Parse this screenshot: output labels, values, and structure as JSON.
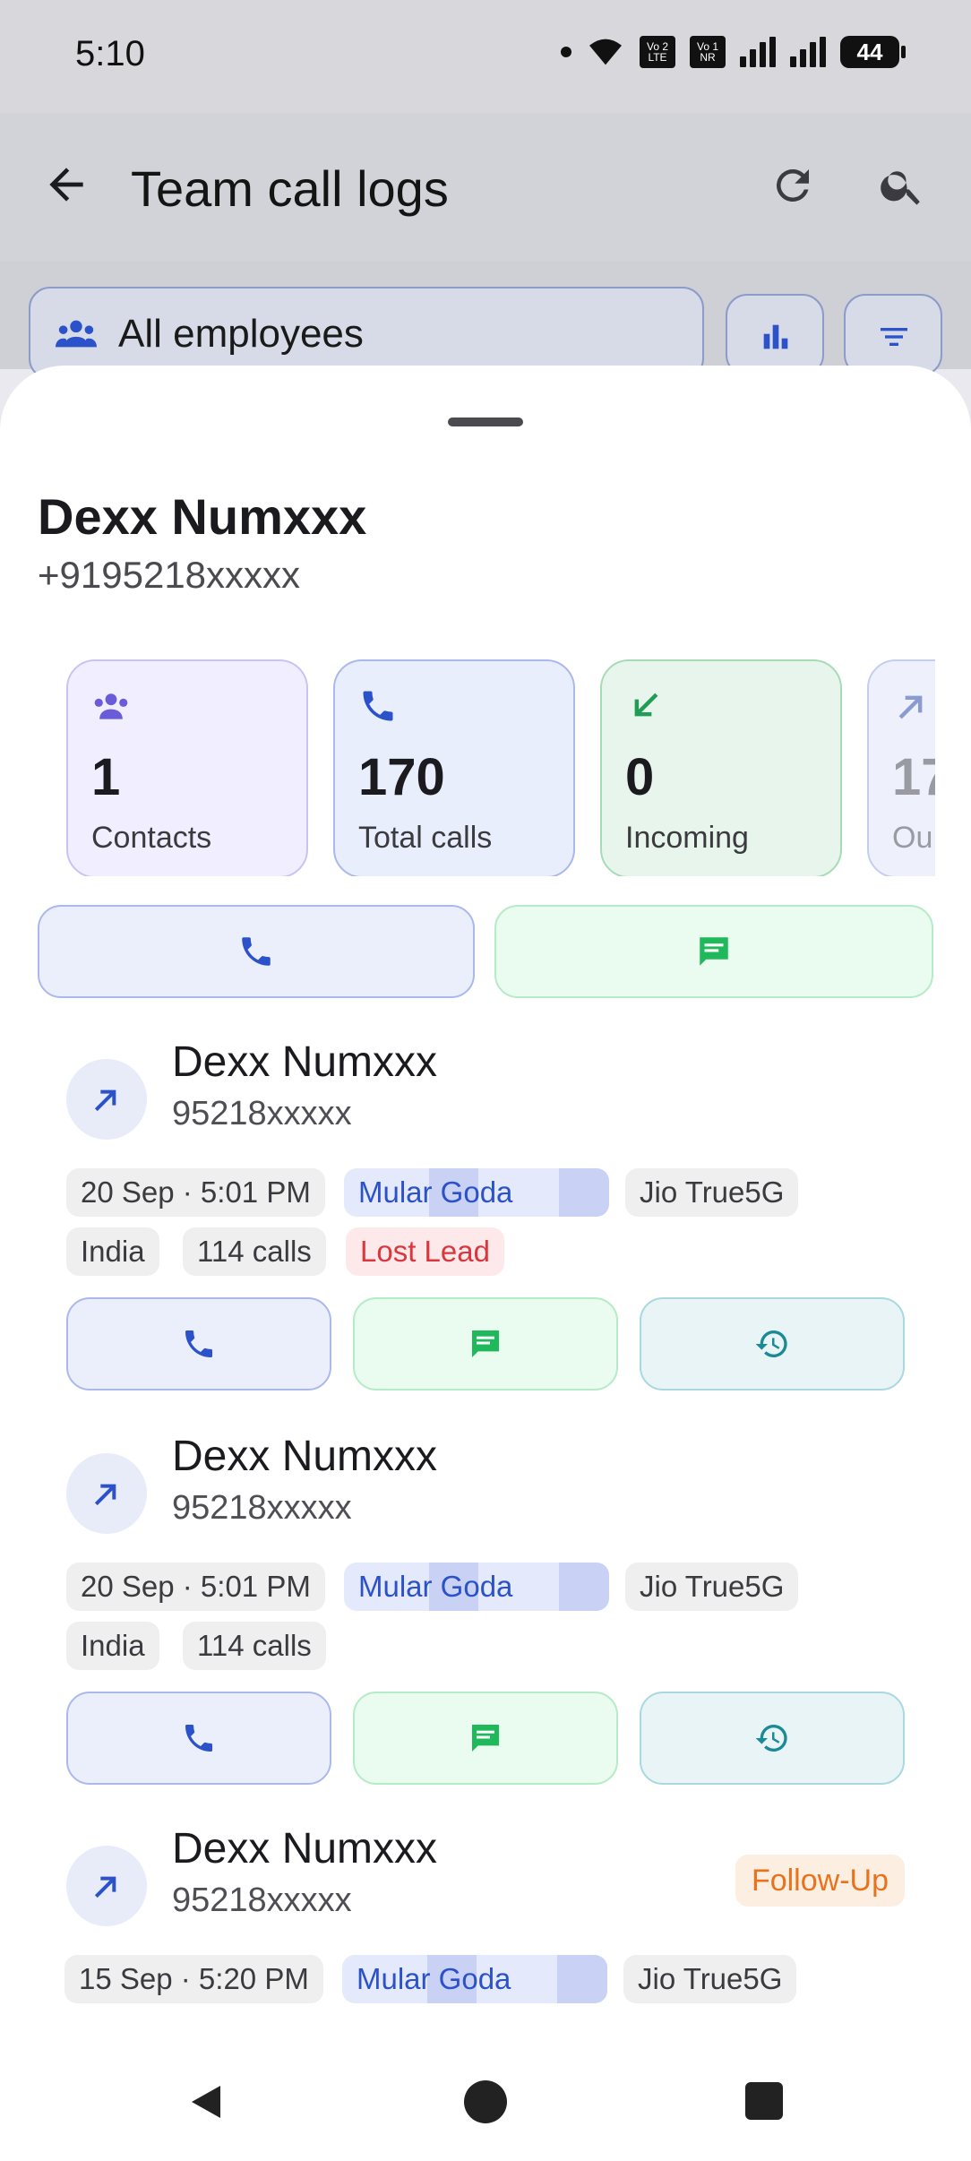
{
  "status_bar": {
    "time": "5:10",
    "sim1_label": "Vo 2 LTE",
    "sim2_label": "Vo 1 NR",
    "battery": "44"
  },
  "app_bar": {
    "title": "Team call logs"
  },
  "filter": {
    "employees_label": "All employees"
  },
  "sheet": {
    "name": "Dexx Numxxx",
    "phone": "+9195218xxxxx",
    "stats": [
      {
        "value": "1",
        "label": "Contacts",
        "icon": "group-icon",
        "color": "#6a5bd8"
      },
      {
        "value": "170",
        "label": "Total calls",
        "icon": "phone-icon",
        "color": "#2c52c9"
      },
      {
        "value": "0",
        "label": "Incoming",
        "icon": "incoming-arrow-icon",
        "color": "#1f9d55"
      },
      {
        "value": "17",
        "label": "Ou",
        "icon": "outgoing-arrow-icon",
        "color": "#8a9bd0"
      }
    ]
  },
  "logs": [
    {
      "name": "Dexx Numxxx",
      "number": "95218xxxxx",
      "datetime": "20 Sep · 5:01 PM",
      "employee": "Mular Goda",
      "network": "Jio True5G",
      "country": "India",
      "calls": "114 calls",
      "tag": "Lost Lead"
    },
    {
      "name": "Dexx Numxxx",
      "number": "95218xxxxx",
      "datetime": "20 Sep · 5:01 PM",
      "employee": "Mular Goda",
      "network": "Jio True5G",
      "country": "India",
      "calls": "114 calls"
    },
    {
      "name": "Dexx Numxxx",
      "number": "95218xxxxx",
      "datetime": "15 Sep · 5:20 PM",
      "employee": "Mular Goda",
      "network": "Jio True5G",
      "badge": "Follow-Up"
    }
  ],
  "colors": {
    "call_blue": "#2c52c9",
    "sms_green": "#1fb85a",
    "history_teal": "#1a8a96"
  }
}
